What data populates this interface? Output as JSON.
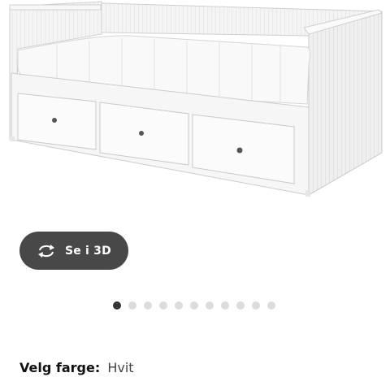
{
  "product": {
    "image_alt": "White daybed with three drawers and mattress"
  },
  "view_3d": {
    "label": "Se i 3D",
    "icon": "rotate-arrows-icon"
  },
  "carousel": {
    "total": 11,
    "active_index": 0
  },
  "color_selection": {
    "label": "Velg farge:",
    "value": "Hvit"
  },
  "colors": {
    "button_bg": "#484848",
    "dot_active": "#333333",
    "dot_inactive": "#dcdcdc"
  }
}
